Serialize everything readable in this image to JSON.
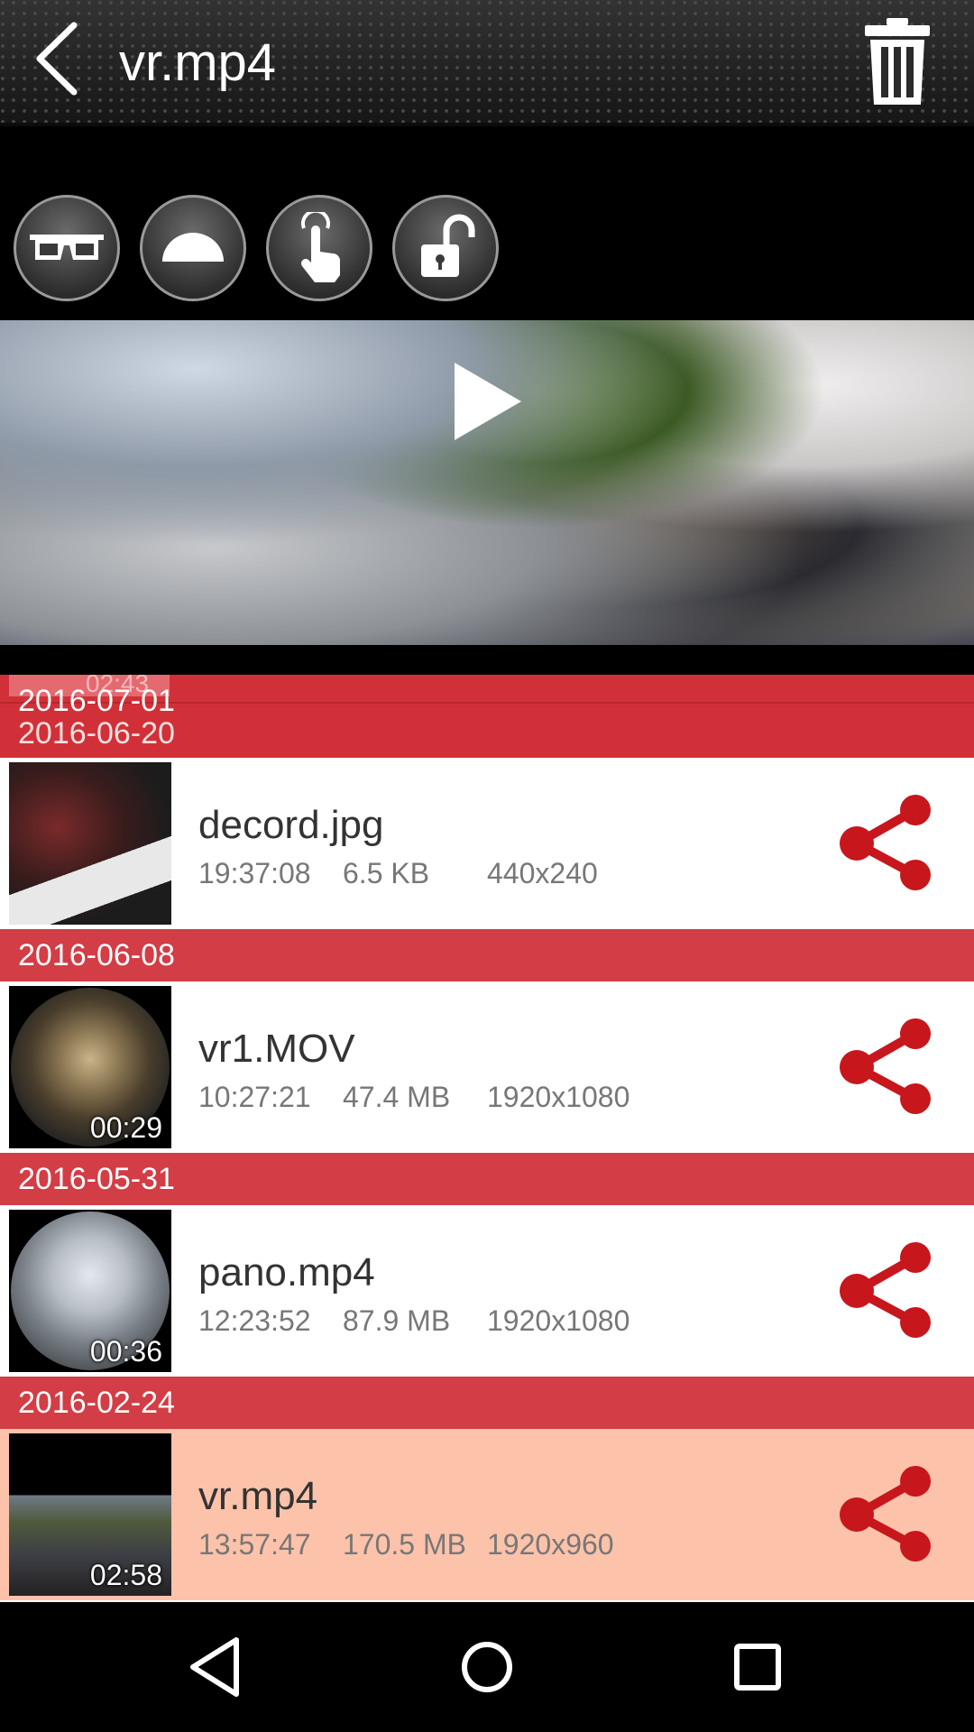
{
  "header": {
    "title": "vr.mp4"
  },
  "vr_controls": [
    {
      "icon": "vr-glasses-icon"
    },
    {
      "icon": "dome-icon"
    },
    {
      "icon": "touch-icon"
    },
    {
      "icon": "unlock-icon"
    }
  ],
  "ghost": {
    "time": "02:43",
    "date1": "2016-07-01",
    "date2": "2016-06-20"
  },
  "groups": [
    {
      "date": "2016-06-20",
      "item": {
        "name": "decord.jpg",
        "time": "19:37:08",
        "size": "6.5 KB",
        "resolution": "440x240",
        "duration": ""
      }
    },
    {
      "date": "2016-06-08",
      "item": {
        "name": "vr1.MOV",
        "time": "10:27:21",
        "size": "47.4 MB",
        "resolution": "1920x1080",
        "duration": "00:29"
      }
    },
    {
      "date": "2016-05-31",
      "item": {
        "name": "pano.mp4",
        "time": "12:23:52",
        "size": "87.9 MB",
        "resolution": "1920x1080",
        "duration": "00:36"
      }
    },
    {
      "date": "2016-02-24",
      "item": {
        "name": "vr.mp4",
        "time": "13:57:47",
        "size": "170.5 MB",
        "resolution": "1920x960",
        "duration": "02:58",
        "selected": true
      }
    }
  ],
  "colors": {
    "accent": "#d33d45",
    "selected_row": "#fdc2aa",
    "share_icon": "#c8161d"
  }
}
